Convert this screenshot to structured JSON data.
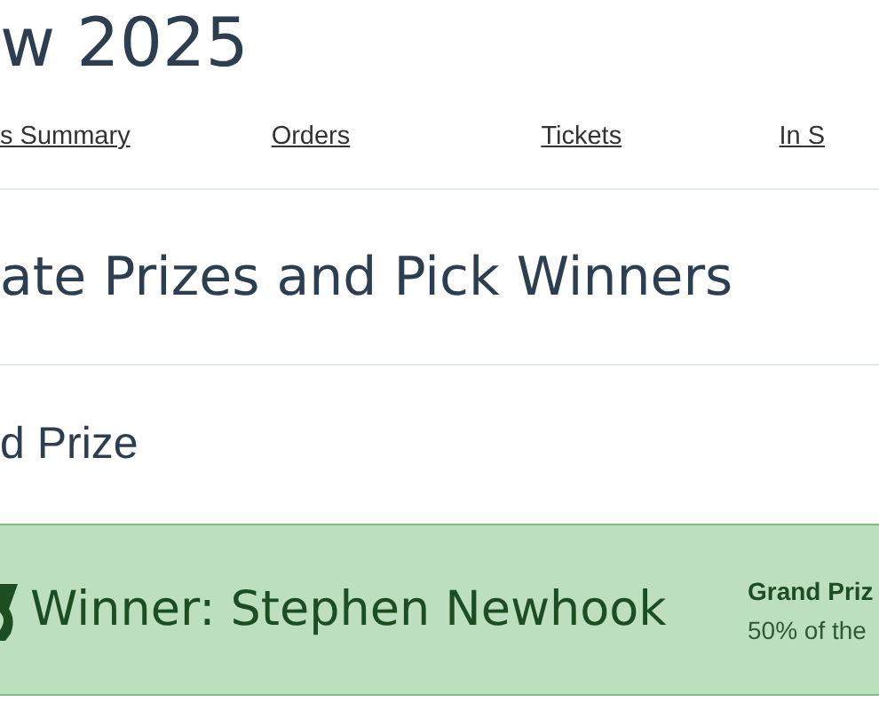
{
  "page_title": "w 2025",
  "tabs": [
    {
      "label": "s Summary",
      "selected": false
    },
    {
      "label": "Orders",
      "selected": false
    },
    {
      "label": "Tickets",
      "selected": false
    },
    {
      "label": "In S",
      "selected": false
    }
  ],
  "section_heading": "ate Prizes and Pick Winners",
  "prize_heading": "d Prize",
  "winner_card": {
    "title": "Winner: Stephen Newhook",
    "prize_name": "Grand Priz",
    "prize_description": "50% of the"
  }
}
